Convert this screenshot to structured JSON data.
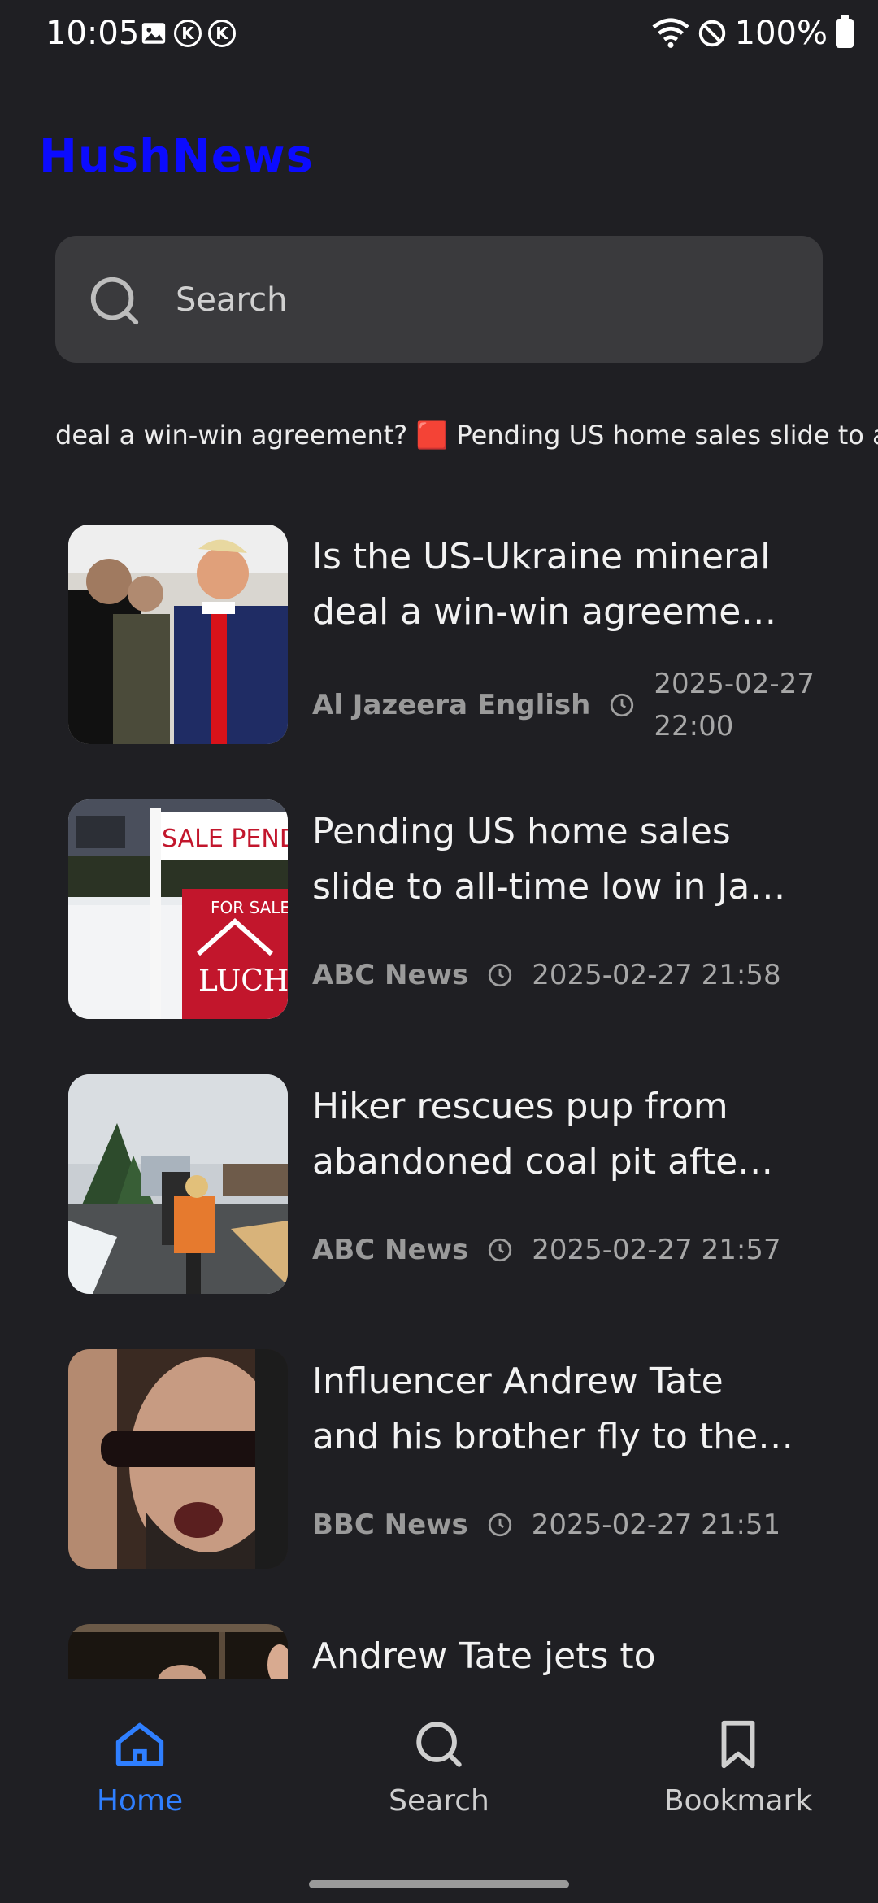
{
  "status_bar": {
    "time": "10:05",
    "battery": "100%"
  },
  "app": {
    "title": "HushNews",
    "title_color": "#0b0bff"
  },
  "search": {
    "placeholder": "Search"
  },
  "ticker": {
    "text": "deal a win-win agreement? 🟥 Pending US home sales slide to all"
  },
  "news": [
    {
      "headline": "Is the US-Ukraine mineral deal a win-win agreeme…",
      "source": "Al Jazeera English",
      "time": "2025-02-27 22:00"
    },
    {
      "headline": "Pending US home sales slide to all-time low in Ja…",
      "source": "ABC News",
      "time": "2025-02-27 21:58"
    },
    {
      "headline": "Hiker rescues pup from abandoned coal pit afte…",
      "source": "ABC News",
      "time": "2025-02-27 21:57"
    },
    {
      "headline": "Influencer Andrew Tate and his brother fly to the…",
      "source": "BBC News",
      "time": "2025-02-27 21:51"
    },
    {
      "headline": "Andrew Tate jets to",
      "source": "",
      "time": ""
    }
  ],
  "bottom_nav": {
    "items": [
      {
        "label": "Home",
        "icon": "home-icon",
        "active": true
      },
      {
        "label": "Search",
        "icon": "search-icon",
        "active": false
      },
      {
        "label": "Bookmark",
        "icon": "bookmark-icon",
        "active": false
      }
    ],
    "active_color": "#2f7fff"
  }
}
